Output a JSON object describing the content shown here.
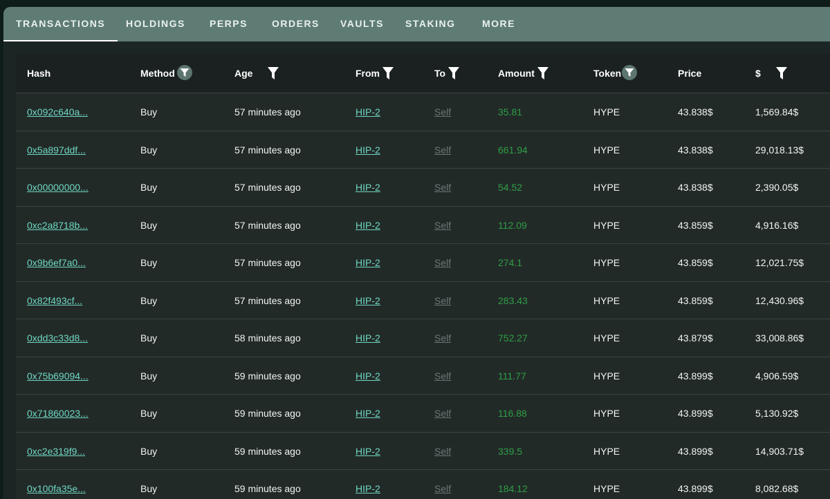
{
  "tabs": [
    {
      "label": "TRANSACTIONS",
      "active": true
    },
    {
      "label": "HOLDINGS"
    },
    {
      "label": "PERPS"
    },
    {
      "label": "ORDERS"
    },
    {
      "label": "VAULTS"
    },
    {
      "label": "STAKING"
    },
    {
      "label": "MORE"
    }
  ],
  "table": {
    "headers": {
      "hash": "Hash",
      "method": "Method",
      "age": "Age",
      "from": "From",
      "to": "To",
      "amount": "Amount",
      "token": "Token",
      "price": "Price",
      "usd": "$"
    },
    "rows": [
      {
        "hash": "0x092c640a...",
        "method": "Buy",
        "age": "57 minutes ago",
        "from": "HIP-2",
        "to": "Self",
        "amount": "35.81",
        "token": "HYPE",
        "price": "43.838$",
        "usd": "1,569.84$"
      },
      {
        "hash": "0x5a897ddf...",
        "method": "Buy",
        "age": "57 minutes ago",
        "from": "HIP-2",
        "to": "Self",
        "amount": "661.94",
        "token": "HYPE",
        "price": "43.838$",
        "usd": "29,018.13$"
      },
      {
        "hash": "0x00000000...",
        "method": "Buy",
        "age": "57 minutes ago",
        "from": "HIP-2",
        "to": "Self",
        "amount": "54.52",
        "token": "HYPE",
        "price": "43.838$",
        "usd": "2,390.05$"
      },
      {
        "hash": "0xc2a8718b...",
        "method": "Buy",
        "age": "57 minutes ago",
        "from": "HIP-2",
        "to": "Self",
        "amount": "112.09",
        "token": "HYPE",
        "price": "43.859$",
        "usd": "4,916.16$"
      },
      {
        "hash": "0x9b6ef7a0...",
        "method": "Buy",
        "age": "57 minutes ago",
        "from": "HIP-2",
        "to": "Self",
        "amount": "274.1",
        "token": "HYPE",
        "price": "43.859$",
        "usd": "12,021.75$"
      },
      {
        "hash": "0x82f493cf...",
        "method": "Buy",
        "age": "57 minutes ago",
        "from": "HIP-2",
        "to": "Self",
        "amount": "283.43",
        "token": "HYPE",
        "price": "43.859$",
        "usd": "12,430.96$"
      },
      {
        "hash": "0xdd3c33d8...",
        "method": "Buy",
        "age": "58 minutes ago",
        "from": "HIP-2",
        "to": "Self",
        "amount": "752.27",
        "token": "HYPE",
        "price": "43.879$",
        "usd": "33,008.86$"
      },
      {
        "hash": "0x75b69094...",
        "method": "Buy",
        "age": "59 minutes ago",
        "from": "HIP-2",
        "to": "Self",
        "amount": "111.77",
        "token": "HYPE",
        "price": "43.899$",
        "usd": "4,906.59$"
      },
      {
        "hash": "0x71860023...",
        "method": "Buy",
        "age": "59 minutes ago",
        "from": "HIP-2",
        "to": "Self",
        "amount": "116.88",
        "token": "HYPE",
        "price": "43.899$",
        "usd": "5,130.92$"
      },
      {
        "hash": "0xc2e319f9...",
        "method": "Buy",
        "age": "59 minutes ago",
        "from": "HIP-2",
        "to": "Self",
        "amount": "339.5",
        "token": "HYPE",
        "price": "43.899$",
        "usd": "14,903.71$"
      },
      {
        "hash": "0x100fa35e...",
        "method": "Buy",
        "age": "59 minutes ago",
        "from": "HIP-2",
        "to": "Self",
        "amount": "184.12",
        "token": "HYPE",
        "price": "43.899$",
        "usd": "8,082.68$"
      }
    ]
  },
  "icons": {
    "column_filter": "funnel-icon"
  },
  "colors": {
    "tab_bar": "#5f7c74",
    "link": "#6fd7c2",
    "amount": "#2f9e45",
    "self": "#6b7876"
  }
}
